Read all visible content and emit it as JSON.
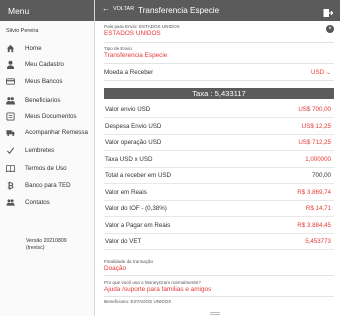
{
  "sidebar": {
    "title": "Menu",
    "user": "Silvio Pereira",
    "items": [
      {
        "label": "Home",
        "icon": "home-icon"
      },
      {
        "label": "Meu Cadastro",
        "icon": "person-icon"
      },
      {
        "label": "Meus Bancos",
        "icon": "bank-card-icon"
      },
      {
        "label": "Beneficiarios",
        "icon": "people-icon"
      },
      {
        "label": "Meus Documentos",
        "icon": "document-icon"
      },
      {
        "label": "Acompanhar Remessa",
        "icon": "truck-icon"
      },
      {
        "label": "Lembretes",
        "icon": "check-icon"
      },
      {
        "label": "Termos de Uso",
        "icon": "book-icon"
      },
      {
        "label": "Banco para TED",
        "icon": "bitcoin-icon"
      },
      {
        "label": "Contatos",
        "icon": "contacts-icon"
      }
    ],
    "version_line1": "Versão 20210809",
    "version_line2": "(trevisc)"
  },
  "header": {
    "back_label": "VOLTAR",
    "title": "Transferencia Especie"
  },
  "form": {
    "pais_label": "País para Envio: ESTADOS UNIDOS",
    "pais_value": "ESTADOS UNIDOS",
    "tipo_label": "Tipo de Envio",
    "tipo_value": "Transferencia Especie",
    "moeda_label": "Moeda a Receber",
    "moeda_value": "USD",
    "taxa": "Taxa : 5,433117"
  },
  "rows": [
    {
      "label": "Valor envio USD",
      "value": "US$ 700,00",
      "color": "#e53935"
    },
    {
      "label": "Despesa Envio USD",
      "value": "US$ 12,25",
      "color": "#e53935"
    },
    {
      "label": "Valor operação USD",
      "value": "US$ 712,25",
      "color": "#e53935"
    },
    {
      "label": "Taxa USD x USD",
      "value": "1,000000",
      "color": "#e53935"
    },
    {
      "label": "Total a receber em USD",
      "value": "700,00",
      "color": "#333333"
    },
    {
      "label": "Valor em Reais",
      "value": "R$ 3.869,74",
      "color": "#e53935"
    },
    {
      "label": "Valor do IOF - (0,38%)",
      "value": "R$ 14,71",
      "color": "#e53935"
    },
    {
      "label": "Valor a Pagar em Reais",
      "value": "R$ 3.884,45",
      "color": "#e53935"
    },
    {
      "label": "Valor do VET",
      "value": "5,453773",
      "color": "#e53935"
    }
  ],
  "bottom": {
    "finalidade_label": "Finalidade da transação",
    "finalidade_value": "Doação",
    "porque_label": "Por que você usa o MoneyGram normalmente?",
    "porque_value": "Ajuda /suporte para famílias e amigos",
    "beneficiario_label": "Beneficiario: ESTADOS UNIDOS"
  },
  "colors": {
    "accent": "#e53935",
    "header": "#5b5b5b"
  }
}
